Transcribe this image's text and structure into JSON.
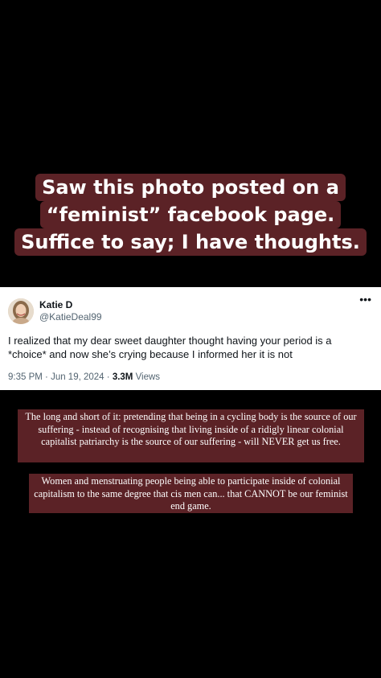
{
  "headline": {
    "lines": [
      "Saw this photo posted on a",
      "“feminist” facebook page.",
      "Suffice to say; I have thoughts."
    ]
  },
  "tweet": {
    "name": "Katie D",
    "handle": "@KatieDeal99",
    "text": "I realized that my dear sweet daughter thought having your period is a *choice* and now she’s crying because I informed her it is not",
    "time": "9:35 PM",
    "date": "Jun 19, 2024",
    "views_count": "3.3M",
    "views_label": "Views",
    "more_icon": "more-horizontal-icon",
    "avatar_icon": "profile-photo"
  },
  "comments": [
    "The long and short of it: pretending that being in a cycling body is the source of our suffering - instead of recognising that living inside of a ridigly linear colonial capitalist patriarchy is the source of our suffering - will NEVER get us free.",
    "Women and menstruating people being able to participate inside of colonial capitalism to the same degree that cis men can... that CANNOT be our feminist end game."
  ],
  "colors": {
    "background": "#000000",
    "caption_box": "#5b2226",
    "card": "#ffffff",
    "secondary_text": "#536471"
  }
}
